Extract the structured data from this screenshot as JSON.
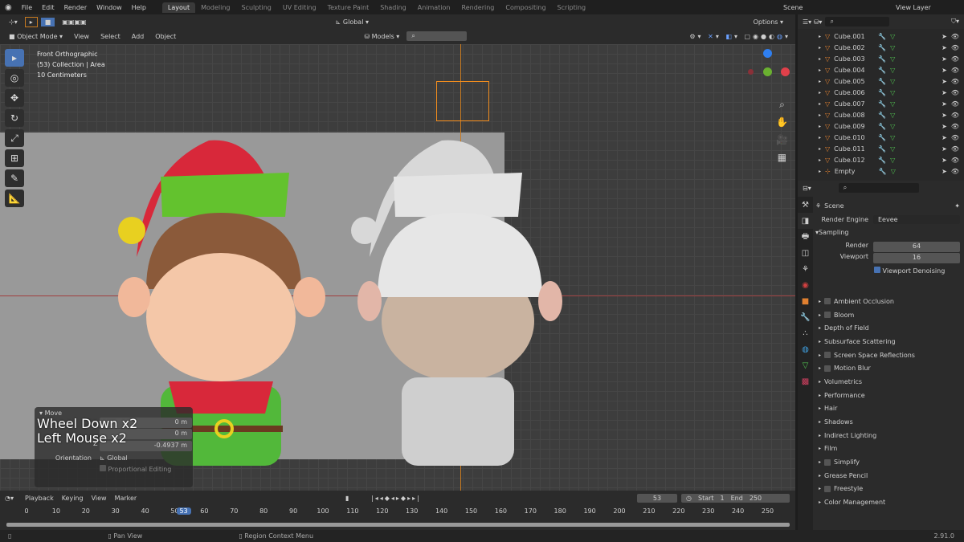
{
  "topbar": {
    "menus": [
      "File",
      "Edit",
      "Render",
      "Window",
      "Help"
    ],
    "workspaces": [
      "Layout",
      "Modeling",
      "Sculpting",
      "UV Editing",
      "Texture Paint",
      "Shading",
      "Animation",
      "Rendering",
      "Compositing",
      "Scripting"
    ],
    "active_workspace": "Layout",
    "scene": "Scene",
    "view_layer": "View Layer"
  },
  "header": {
    "mode": "Object Mode",
    "menus": [
      "View",
      "Select",
      "Add",
      "Object"
    ],
    "orientation": "Global",
    "collection": "Models",
    "options": "Options"
  },
  "viewport": {
    "view_name": "Front Orthographic",
    "collection": "(53) Collection | Area",
    "scale": "10 Centimeters"
  },
  "operator_panel": {
    "title": "Move",
    "x": "0 m",
    "y": "0 m",
    "z_label": "Z",
    "z": "-0.4937 m",
    "orientation_label": "Orientation",
    "orientation": "Global",
    "proportional": "Proportional Editing"
  },
  "keystrokes": [
    "Wheel Down x2",
    "Left Mouse x2"
  ],
  "outliner": {
    "items": [
      "Cube.001",
      "Cube.002",
      "Cube.003",
      "Cube.004",
      "Cube.005",
      "Cube.006",
      "Cube.007",
      "Cube.008",
      "Cube.009",
      "Cube.010",
      "Cube.011",
      "Cube.012",
      "Empty"
    ]
  },
  "properties": {
    "scene": "Scene",
    "render_engine_label": "Render Engine",
    "render_engine": "Eevee",
    "sampling": "Sampling",
    "render_label": "Render",
    "render": "64",
    "viewport_label": "Viewport",
    "viewport": "16",
    "denoise": "Viewport Denoising",
    "sections": [
      {
        "label": "Ambient Occlusion",
        "check": true
      },
      {
        "label": "Bloom",
        "check": true
      },
      {
        "label": "Depth of Field",
        "check": false
      },
      {
        "label": "Subsurface Scattering",
        "check": false
      },
      {
        "label": "Screen Space Reflections",
        "check": true
      },
      {
        "label": "Motion Blur",
        "check": true
      },
      {
        "label": "Volumetrics",
        "check": false
      },
      {
        "label": "Performance",
        "check": false
      },
      {
        "label": "Hair",
        "check": false
      },
      {
        "label": "Shadows",
        "check": false
      },
      {
        "label": "Indirect Lighting",
        "check": false
      },
      {
        "label": "Film",
        "check": false
      },
      {
        "label": "Simplify",
        "check": true
      },
      {
        "label": "Grease Pencil",
        "check": false
      },
      {
        "label": "Freestyle",
        "check": true
      },
      {
        "label": "Color Management",
        "check": false
      }
    ]
  },
  "timeline": {
    "menus": [
      "Playback",
      "Keying",
      "View",
      "Marker"
    ],
    "current_frame": "53",
    "start_label": "Start",
    "start": "1",
    "end_label": "End",
    "end": "250",
    "ticks": [
      "0",
      "10",
      "20",
      "30",
      "40",
      "50",
      "60",
      "70",
      "80",
      "90",
      "100",
      "110",
      "120",
      "130",
      "140",
      "150",
      "160",
      "170",
      "180",
      "190",
      "200",
      "210",
      "220",
      "230",
      "240",
      "250"
    ]
  },
  "status": {
    "items": [
      "",
      "Pan View",
      "Region Context Menu"
    ],
    "version": "2.91.0"
  },
  "colors": {
    "accent": "#4772b3",
    "selected_outline": "#f08c1e"
  }
}
